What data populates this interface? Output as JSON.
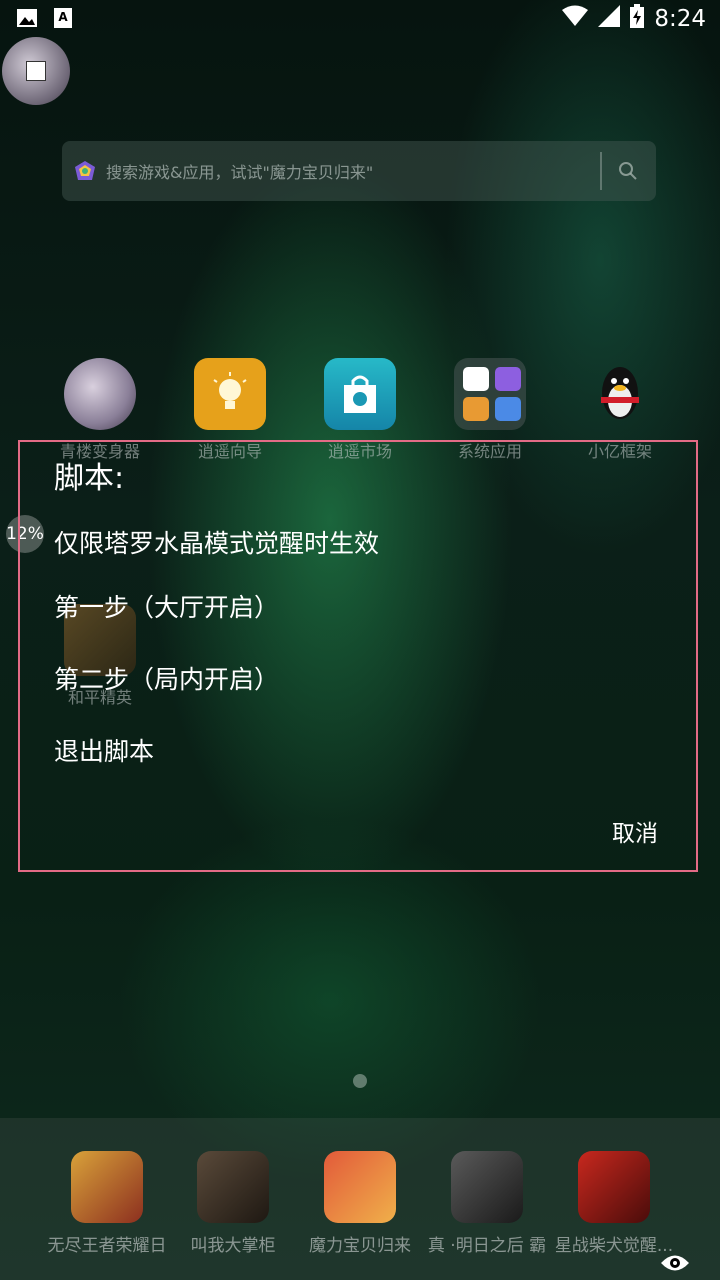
{
  "status_bar": {
    "time": "8:24",
    "left_icons": [
      "image-icon",
      "a-notification-icon"
    ],
    "right_icons": [
      "wifi-icon",
      "signal-icon",
      "battery-charging-icon"
    ]
  },
  "search": {
    "placeholder": "搜索游戏&应用，试试\"魔力宝贝归来\""
  },
  "apps": [
    {
      "label": "青楼变身器",
      "icon": "anime-avatar-icon"
    },
    {
      "label": "逍遥向导",
      "icon": "lightbulb-icon",
      "color": "#e6a11b"
    },
    {
      "label": "逍遥市场",
      "icon": "shopping-bag-icon",
      "color": "#1aa6b8"
    },
    {
      "label": "系统应用",
      "icon": "folder-icon"
    },
    {
      "label": "小亿框架",
      "icon": "penguin-icon"
    }
  ],
  "second_row_app": {
    "label": "和平精英",
    "icon": "game-icon"
  },
  "progress_badge": "12%",
  "dialog": {
    "title": "脚本:",
    "items": [
      "仅限塔罗水晶模式觉醒时生效",
      "第一步（大厅开启）",
      "第二步（局内开启）",
      "退出脚本"
    ],
    "cancel": "取消",
    "border_color": "#e36b86"
  },
  "dock": [
    {
      "label": "无尽王者荣耀日",
      "icon": "game-icon"
    },
    {
      "label": "叫我大掌柜",
      "icon": "game-icon"
    },
    {
      "label": "魔力宝贝归来",
      "icon": "game-icon"
    },
    {
      "label": "真 ·明日之后 霸",
      "icon": "game-icon"
    },
    {
      "label": "星战柴犬觉醒...",
      "icon": "game-icon"
    }
  ]
}
